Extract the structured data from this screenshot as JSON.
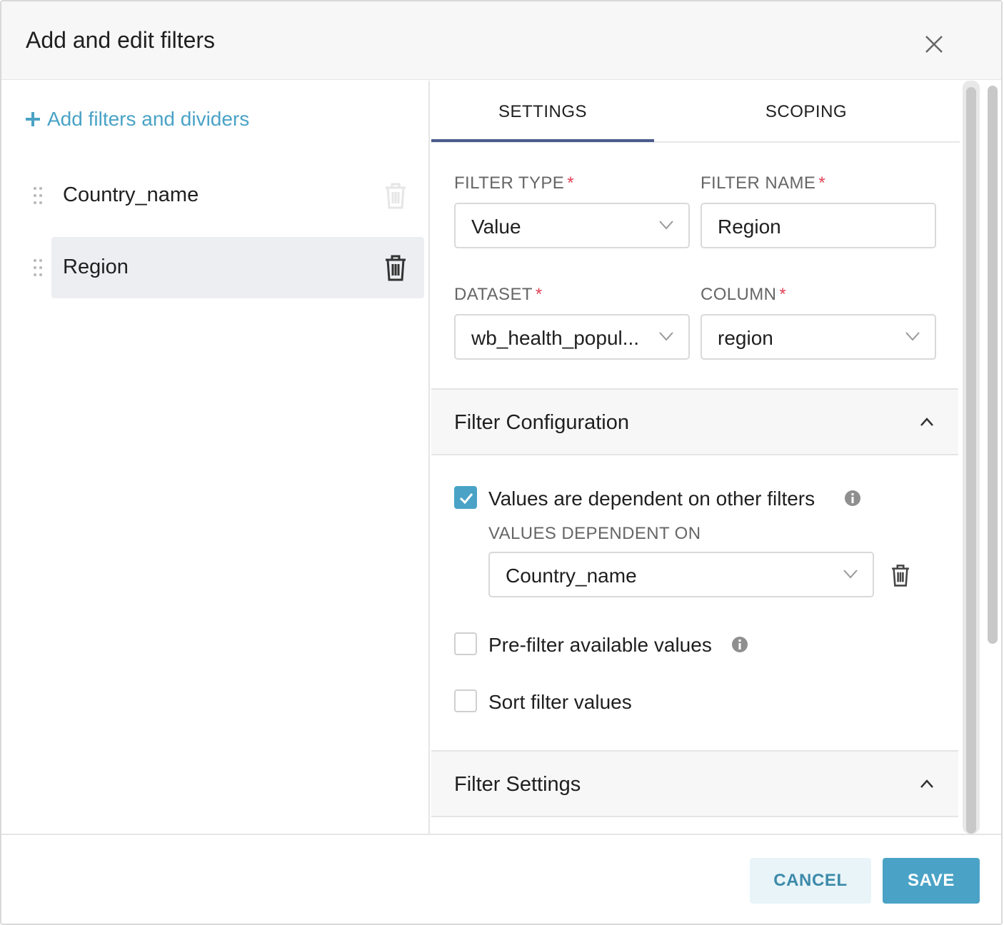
{
  "modal": {
    "title": "Add and edit filters"
  },
  "left_panel": {
    "add_link": "Add filters and dividers",
    "filters": [
      {
        "label": "Country_name",
        "active": false
      },
      {
        "label": "Region",
        "active": true
      }
    ]
  },
  "tabs": [
    {
      "label": "SETTINGS",
      "selected": true
    },
    {
      "label": "SCOPING",
      "selected": false
    }
  ],
  "fields": {
    "filter_type": {
      "label": "FILTER TYPE",
      "value": "Value",
      "required_mark": "*"
    },
    "filter_name": {
      "label": "FILTER NAME",
      "value": "Region",
      "required_mark": "*"
    },
    "dataset": {
      "label": "DATASET",
      "value": "wb_health_popul...",
      "required_mark": "*"
    },
    "column": {
      "label": "COLUMN",
      "value": "region",
      "required_mark": "*"
    }
  },
  "filter_configuration": {
    "title": "Filter Configuration",
    "dependent": {
      "label": "Values are dependent on other filters",
      "checked": true
    },
    "dependent_on_label": "VALUES DEPENDENT ON",
    "dependent_on_value": "Country_name",
    "prefilter": {
      "label": "Pre-filter available values",
      "checked": false
    },
    "sort": {
      "label": "Sort filter values",
      "checked": false
    }
  },
  "filter_settings": {
    "title": "Filter Settings"
  },
  "footer": {
    "cancel_label": "CANCEL",
    "save_label": "SAVE"
  },
  "colors": {
    "accent": "#4aa3c6",
    "tab_underline": "#4a5b8c",
    "required": "#e04355"
  },
  "icons": [
    "close-icon",
    "plus-icon",
    "drag-handle-icon",
    "trash-icon",
    "chevron-down-icon",
    "chevron-up-icon",
    "info-icon",
    "checkmark-icon"
  ]
}
